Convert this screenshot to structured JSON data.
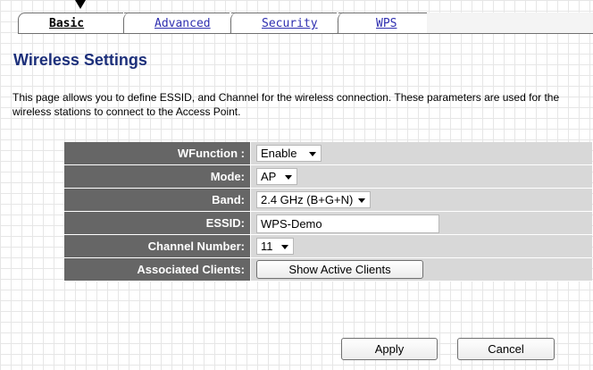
{
  "tabs": [
    {
      "label": "Basic",
      "active": true
    },
    {
      "label": "Advanced",
      "active": false
    },
    {
      "label": "Security",
      "active": false
    },
    {
      "label": "WPS",
      "active": false
    }
  ],
  "page": {
    "title": "Wireless Settings",
    "description": "This page allows you to define ESSID, and Channel for the wireless connection. These parameters are used for the wireless stations to connect to the Access Point."
  },
  "form": {
    "wfunction": {
      "label": "WFunction :",
      "value": "Enable"
    },
    "mode": {
      "label": "Mode:",
      "value": "AP"
    },
    "band": {
      "label": "Band:",
      "value": "2.4 GHz (B+G+N)"
    },
    "essid": {
      "label": "ESSID:",
      "value": "WPS-Demo"
    },
    "channel": {
      "label": "Channel Number:",
      "value": "11"
    },
    "clients": {
      "label": "Associated Clients:",
      "button": "Show Active Clients"
    }
  },
  "actions": {
    "apply": "Apply",
    "cancel": "Cancel"
  },
  "colors": {
    "title": "#1c2f7a",
    "label_bg": "#666666",
    "field_bg": "#d8d8d8",
    "tab_link": "#2f2fb0"
  }
}
